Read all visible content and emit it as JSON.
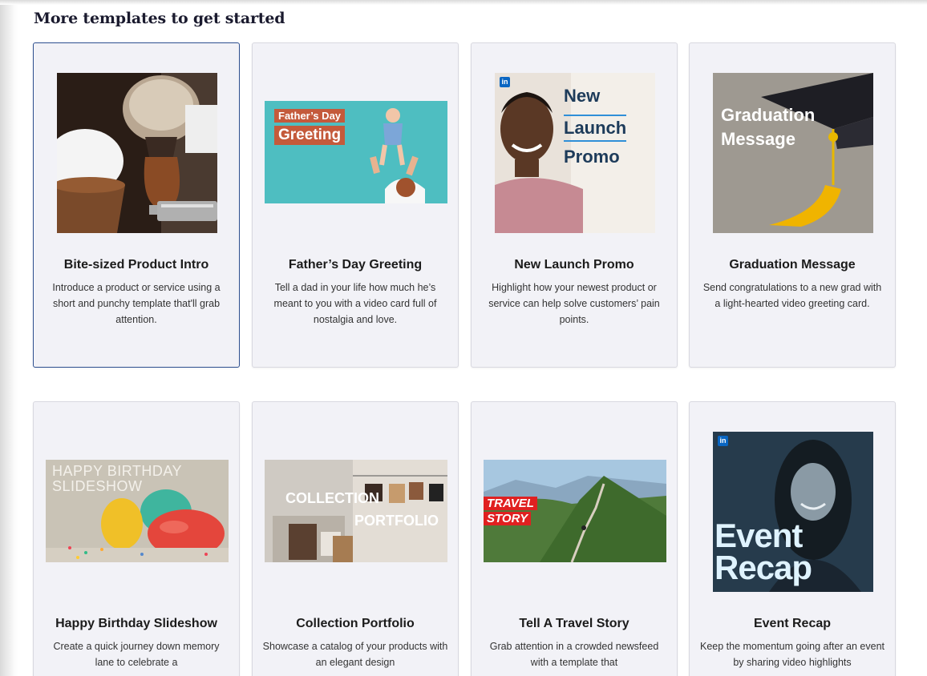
{
  "page": {
    "heading": "More templates to get started"
  },
  "cards": [
    {
      "title": "Bite-sized Product Intro",
      "desc": "Introduce a product or service using a short and punchy template that'll grab attention.",
      "thumb_icon": "shaving-brush-image"
    },
    {
      "title": "Father’s Day Greeting",
      "desc": "Tell a dad in your life how much he’s meant to you with a video card full of nostalgia and love.",
      "thumb_icon": "father-child-image",
      "overlay": [
        "Father’s Day",
        "Greeting"
      ]
    },
    {
      "title": "New Launch Promo",
      "desc": "Highlight how your newest product or service can help solve customers’ pain points.",
      "thumb_icon": "smiling-man-image",
      "overlay": [
        "New",
        "Launch",
        "Promo"
      ],
      "badge": "in"
    },
    {
      "title": "Graduation Message",
      "desc": "Send congratulations to a new grad with a light-hearted video greeting card.",
      "thumb_icon": "graduation-cap-image",
      "overlay": [
        "Graduation",
        "Message"
      ]
    },
    {
      "title": "Happy Birthday Slideshow",
      "desc": "Create a quick journey down memory lane to celebrate a",
      "thumb_icon": "balloons-image",
      "overlay": [
        "HAPPY BIRTHDAY",
        "SLIDESHOW"
      ]
    },
    {
      "title": "Collection Portfolio",
      "desc": "Showcase a catalog of your products with an elegant design",
      "thumb_icon": "handbags-image",
      "overlay": [
        "COLLECTION",
        "PORTFOLIO"
      ]
    },
    {
      "title": "Tell A Travel Story",
      "desc": "Grab attention in a crowded newsfeed with a template that",
      "thumb_icon": "mountain-trail-image",
      "overlay": [
        "TRAVEL",
        "STORY"
      ]
    },
    {
      "title": "Event Recap",
      "desc": "Keep the momentum going after an event by sharing video highlights",
      "thumb_icon": "smiling-woman-image",
      "overlay": [
        "Event",
        "Recap"
      ],
      "badge": "in"
    }
  ]
}
